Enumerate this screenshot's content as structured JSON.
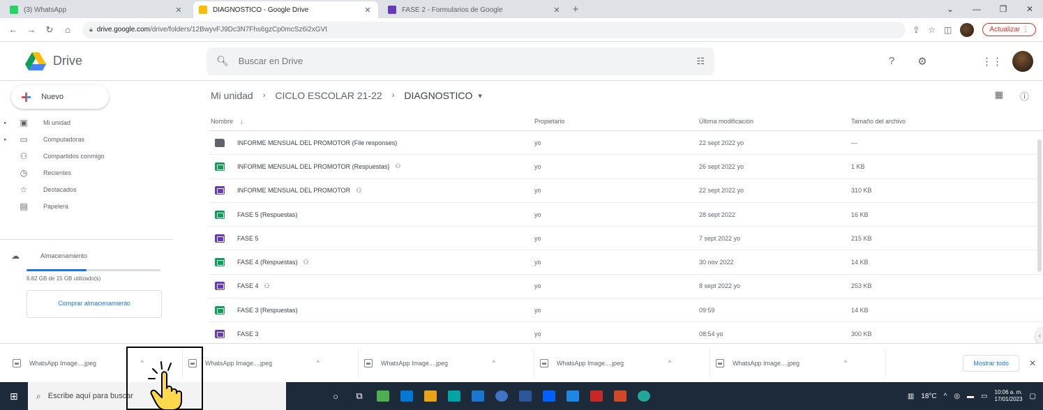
{
  "browser": {
    "tabs": [
      {
        "title": "(3) WhatsApp",
        "close": "✕",
        "color": "#25d366",
        "active": false
      },
      {
        "title": "DIAGNOSTICO - Google Drive",
        "close": "✕",
        "color": "#fbbc04",
        "active": true
      },
      {
        "title": "FASE 2 - Formularios de Google",
        "close": "✕",
        "color": "#673ab7",
        "active": false
      }
    ],
    "new_tab": "+",
    "window_controls": [
      "⌄",
      "—",
      "❐",
      "✕"
    ],
    "address": {
      "host": "drive.google.com",
      "path": "/drive/folders/12BwyvFJ9Dc3N7Fhs6gzCp0mcSz6i2xGVt"
    },
    "update_label": "Actualizar",
    "update_more": "⋮"
  },
  "drive": {
    "app_name": "Drive",
    "search_placeholder": "Buscar en Drive",
    "new_label": "Nuevo",
    "nav": [
      {
        "label": "Mi unidad",
        "icon": "drive-icon",
        "glyph": "▣",
        "caret": "▸"
      },
      {
        "label": "Computadoras",
        "icon": "computer-icon",
        "glyph": "▭",
        "caret": "▸"
      },
      {
        "label": "Compartidos conmigo",
        "icon": "shared-users-icon",
        "glyph": "⚇",
        "caret": ""
      },
      {
        "label": "Recientes",
        "icon": "clock-icon",
        "glyph": "◷",
        "caret": ""
      },
      {
        "label": "Destacados",
        "icon": "star-icon",
        "glyph": "☆",
        "caret": ""
      },
      {
        "label": "Papelera",
        "icon": "trash-icon",
        "glyph": "▤",
        "caret": ""
      }
    ],
    "storage": {
      "label": "Almacenamiento",
      "used_text": "6.82 GB de 15 GB utilizado(s)",
      "used_fraction": 0.45,
      "buy_label": "Comprar almacenamiento"
    },
    "breadcrumb": [
      "Mi unidad",
      "CICLO ESCOLAR 21-22",
      "DIAGNOSTICO"
    ],
    "breadcrumb_sep": "›",
    "columns": {
      "name": "Nombre",
      "owner": "Propietario",
      "modified": "Última modificación",
      "size": "Tamaño del archivo"
    },
    "files": [
      {
        "name": "INFORME MENSUAL DEL PROMOTOR (File responses)",
        "type": "folder",
        "shared": false,
        "owner": "yo",
        "modified": "22 sept 2022 yo",
        "size": "—"
      },
      {
        "name": "INFORME MENSUAL DEL PROMOTOR (Respuestas)",
        "type": "sheet",
        "shared": true,
        "owner": "yo",
        "modified": "26 sept 2022 yo",
        "size": "1 KB"
      },
      {
        "name": "INFORME MENSUAL DEL PROMOTOR",
        "type": "form",
        "shared": true,
        "owner": "yo",
        "modified": "22 sept 2022 yo",
        "size": "310 KB"
      },
      {
        "name": "FASE 5 (Respuestas)",
        "type": "sheet",
        "shared": false,
        "owner": "yo",
        "modified": "28 sept 2022",
        "size": "16 KB"
      },
      {
        "name": "FASE 5",
        "type": "form",
        "shared": false,
        "owner": "yo",
        "modified": "7 sept 2022 yo",
        "size": "215 KB"
      },
      {
        "name": "FASE 4 (Respuestas)",
        "type": "sheet",
        "shared": true,
        "owner": "yo",
        "modified": "30 nov 2022",
        "size": "14 KB"
      },
      {
        "name": "FASE 4",
        "type": "form",
        "shared": true,
        "owner": "yo",
        "modified": "8 sept 2022 yo",
        "size": "253 KB"
      },
      {
        "name": "FASE 3 (Respuestas)",
        "type": "sheet",
        "shared": false,
        "owner": "yo",
        "modified": "09:59",
        "size": "14 KB"
      },
      {
        "name": "FASE 3",
        "type": "form",
        "shared": false,
        "owner": "yo",
        "modified": "08:54 yo",
        "size": "300 KB"
      }
    ]
  },
  "downloads": {
    "items": [
      "WhatsApp Image....jpeg",
      "WhatsApp Image....jpeg",
      "WhatsApp Image....jpeg",
      "WhatsApp Image....jpeg",
      "WhatsApp Image....jpeg"
    ],
    "caret": "^",
    "show_all": "Mostrar todo",
    "close": "✕"
  },
  "taskbar": {
    "search_placeholder": "Escribe aquí para buscar",
    "temperature": "18°C",
    "time": "10:06 a. m.",
    "date": "17/01/2023"
  }
}
